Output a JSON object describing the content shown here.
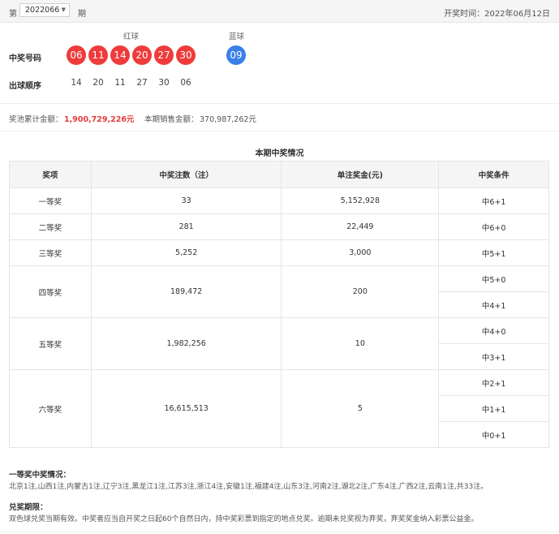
{
  "header": {
    "issue_prefix": "第",
    "issue_value": "2022066",
    "issue_suffix": "期",
    "open_date": "开奖时间：2022年06月12日"
  },
  "balls": {
    "red_header": "红球",
    "blue_header": "蓝球",
    "win_label": "中奖号码",
    "order_label": "出球顺序",
    "red": [
      "06",
      "11",
      "14",
      "20",
      "27",
      "30"
    ],
    "blue": [
      "09"
    ],
    "order": [
      "14",
      "20",
      "11",
      "27",
      "30",
      "06"
    ]
  },
  "pool": {
    "pool_label": "奖池累计金额：",
    "pool_value": "1,900,729,226元",
    "sales_label": "本期销售金额：",
    "sales_value": "370,987,262元"
  },
  "table": {
    "title": "本期中奖情况",
    "headers": [
      "奖项",
      "中奖注数（注）",
      "单注奖金(元)",
      "中奖条件"
    ],
    "rows": [
      {
        "prize": "一等奖",
        "count": "33",
        "amount": "5,152,928",
        "conditions": [
          "中6+1"
        ]
      },
      {
        "prize": "二等奖",
        "count": "281",
        "amount": "22,449",
        "conditions": [
          "中6+0"
        ]
      },
      {
        "prize": "三等奖",
        "count": "5,252",
        "amount": "3,000",
        "conditions": [
          "中5+1"
        ]
      },
      {
        "prize": "四等奖",
        "count": "189,472",
        "amount": "200",
        "conditions": [
          "中5+0",
          "中4+1"
        ]
      },
      {
        "prize": "五等奖",
        "count": "1,982,256",
        "amount": "10",
        "conditions": [
          "中4+0",
          "中3+1"
        ]
      },
      {
        "prize": "六等奖",
        "count": "16,615,513",
        "amount": "5",
        "conditions": [
          "中2+1",
          "中1+1",
          "中0+1"
        ]
      }
    ]
  },
  "first_prize": {
    "title": "一等奖中奖情况：",
    "text": "北京1注,山西1注,内蒙古1注,辽宁3注,黑龙江1注,江苏3注,浙江4注,安徽1注,福建4注,山东3注,河南2注,湖北2注,广东4注,广西2注,云南1注,共33注。"
  },
  "redeem": {
    "title": "兑奖期限：",
    "text": "双色球兑奖当期有效。中奖者应当自开奖之日起60个自然日内，持中奖彩票到指定的地点兑奖。逾期未兑奖视为弃奖，弃奖奖金纳入彩票公益金。"
  },
  "colors": {
    "red_ball": "#ef3b3b",
    "blue_ball": "#3b7fe8",
    "highlight": "#e53b3b"
  }
}
